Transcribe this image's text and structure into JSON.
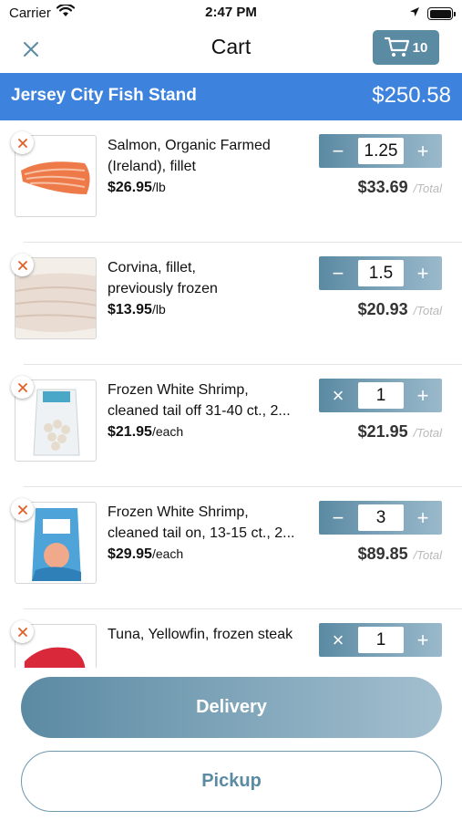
{
  "status_bar": {
    "carrier": "Carrier",
    "time": "2:47 PM"
  },
  "nav": {
    "title": "Cart",
    "cart_count": "10"
  },
  "store": {
    "name": "Jersey City Fish Stand",
    "total": "$250.58"
  },
  "items": [
    {
      "name_line1": "Salmon, Organic Farmed",
      "name_line2": "(Ireland), fillet",
      "price": "$26.95",
      "unit": "/lb",
      "quantity": "1.25",
      "left_action": "−",
      "total": "$33.69",
      "total_suffix": "/Total",
      "image": "salmon-fillet"
    },
    {
      "name_line1": "Corvina, fillet,",
      "name_line2": "previously frozen",
      "price": "$13.95",
      "unit": "/lb",
      "quantity": "1.5",
      "left_action": "−",
      "total": "$20.93",
      "total_suffix": "/Total",
      "image": "corvina-fillet"
    },
    {
      "name_line1": "Frozen White Shrimp,",
      "name_line2": "cleaned tail off 31-40 ct., 2...",
      "price": "$21.95",
      "unit": "/each",
      "quantity": "1",
      "left_action": "×",
      "total": "$21.95",
      "total_suffix": "/Total",
      "image": "shrimp-bag"
    },
    {
      "name_line1": "Frozen White Shrimp,",
      "name_line2": "cleaned tail on, 13-15 ct., 2...",
      "price": "$29.95",
      "unit": "/each",
      "quantity": "3",
      "left_action": "−",
      "total": "$89.85",
      "total_suffix": "/Total",
      "image": "shrimp-package-blue"
    },
    {
      "name_line1": "Tuna, Yellowfin, frozen steak",
      "name_line2": "",
      "price": "",
      "unit": "",
      "quantity": "1",
      "left_action": "×",
      "total": "",
      "total_suffix": "",
      "image": "tuna-steak"
    }
  ],
  "qty_plus": "+",
  "buttons": {
    "delivery": "Delivery",
    "pickup": "Pickup"
  },
  "colors": {
    "accent": "#5b8aa3",
    "banner": "#3d82dd",
    "remove": "#e0602a"
  },
  "icons": {
    "close": "close-icon",
    "cart": "cart-icon",
    "remove": "remove-item-icon",
    "wifi": "wifi-icon",
    "location": "location-arrow-icon",
    "battery": "battery-icon"
  }
}
